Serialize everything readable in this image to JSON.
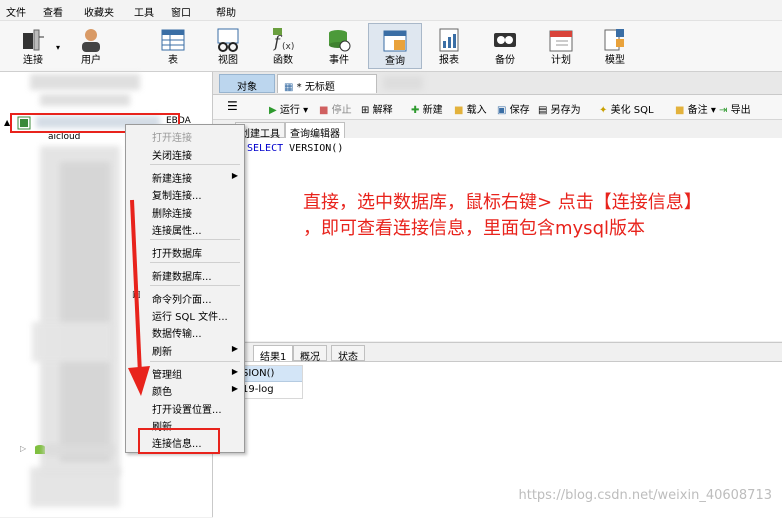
{
  "menu": [
    "文件",
    "查看",
    "收藏夹",
    "工具",
    "窗口",
    "帮助"
  ],
  "toolbar": [
    {
      "label": "连接",
      "icon": "connection-icon"
    },
    {
      "label": "用户",
      "icon": "user-icon"
    },
    {
      "label": "表",
      "icon": "table-icon"
    },
    {
      "label": "视图",
      "icon": "view-icon"
    },
    {
      "label": "函数",
      "icon": "function-icon"
    },
    {
      "label": "事件",
      "icon": "event-icon"
    },
    {
      "label": "查询",
      "icon": "query-icon"
    },
    {
      "label": "报表",
      "icon": "report-icon"
    },
    {
      "label": "备份",
      "icon": "backup-icon"
    },
    {
      "label": "计划",
      "icon": "schedule-icon"
    },
    {
      "label": "模型",
      "icon": "model-icon"
    }
  ],
  "tree": {
    "selected_text": "EBDA",
    "item_text": "aicloud"
  },
  "tabs": {
    "objects": "对象",
    "untitled": "* 无标题"
  },
  "query_toolbar": {
    "run": "运行",
    "stop": "停止",
    "explain": "解释",
    "new": "新建",
    "load": "载入",
    "save": "保存",
    "save_as": "另存为",
    "beautify": "美化 SQL",
    "comment": "备注",
    "export": "导出"
  },
  "subtabs": {
    "builder": "创建工具",
    "editor": "查询编辑器"
  },
  "sql": {
    "kw1": "SELECT",
    "fn": "VERSION()"
  },
  "annotation": {
    "line1": "直接，选中数据库，鼠标右键> 点击【连接信息】",
    "line2": "，即可查看连接信息，里面包含mysql版本"
  },
  "result_tabs": [
    "结果1",
    "概况",
    "状态"
  ],
  "result": {
    "header": "SION()",
    "value": "19-log"
  },
  "context_menu": {
    "open_conn": "打开连接",
    "close_conn": "关闭连接",
    "new_conn": "新建连接",
    "copy_conn": "复制连接...",
    "delete_conn": "删除连接",
    "conn_props": "连接属性...",
    "open_db": "打开数据库",
    "new_db": "新建数据库...",
    "console": "命令列介面...",
    "run_sql": "运行 SQL 文件...",
    "transfer": "数据传输...",
    "refresh1": "刷新",
    "manage_group": "管理组",
    "color": "颜色",
    "open_location": "打开设置位置...",
    "refresh2": "刷新",
    "conn_info": "连接信息..."
  },
  "watermark": "https://blog.csdn.net/weixin_40608713",
  "colors": {
    "highlight": "#e8231c",
    "selection": "#bcd6ee"
  }
}
